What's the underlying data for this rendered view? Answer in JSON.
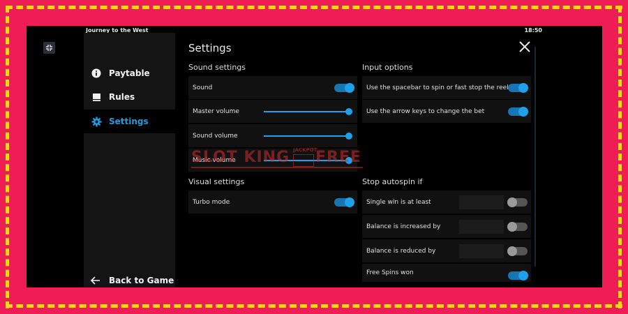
{
  "game_title": "Journey to the West",
  "clock": "18:50",
  "nav": {
    "paytable": "Paytable",
    "rules": "Rules",
    "settings": "Settings",
    "back": "Back to Game"
  },
  "page_title": "Settings",
  "sound_settings": {
    "title": "Sound settings",
    "sound": {
      "label": "Sound",
      "on": true
    },
    "master_volume": {
      "label": "Master volume",
      "level": 1.0
    },
    "sound_volume": {
      "label": "Sound volume",
      "level": 1.0
    },
    "music_volume": {
      "label": "Music volume",
      "level": 1.0
    }
  },
  "visual_settings": {
    "title": "Visual settings",
    "turbo_mode": {
      "label": "Turbo mode",
      "on": true
    }
  },
  "input_options": {
    "title": "Input options",
    "spacebar": {
      "label": "Use the spacebar to spin or fast stop the reels",
      "on": true
    },
    "arrow_keys": {
      "label": "Use the arrow keys to change the bet",
      "on": true
    }
  },
  "stop_autospin": {
    "title": "Stop autospin if",
    "single_win": {
      "label": "Single win is at least",
      "on": false,
      "value": ""
    },
    "balance_increased": {
      "label": "Balance is increased by",
      "on": false,
      "value": ""
    },
    "balance_reduced": {
      "label": "Balance is reduced by",
      "on": false,
      "value": ""
    },
    "free_spins": {
      "label": "Free Spins won",
      "on": true
    }
  },
  "watermark": {
    "left": "SLOT KING",
    "badge": "JACKPOT",
    "right": "FREE"
  },
  "colors": {
    "frame": "#ee1d56",
    "dashes": "#ffd21e",
    "accent": "#1ea0ea",
    "panel": "#111111"
  },
  "icons": {
    "paytable": "info-icon",
    "rules": "book-icon",
    "settings": "gear-icon",
    "back": "arrow-left-icon",
    "close": "close-icon",
    "collapse": "collapse-icon"
  }
}
